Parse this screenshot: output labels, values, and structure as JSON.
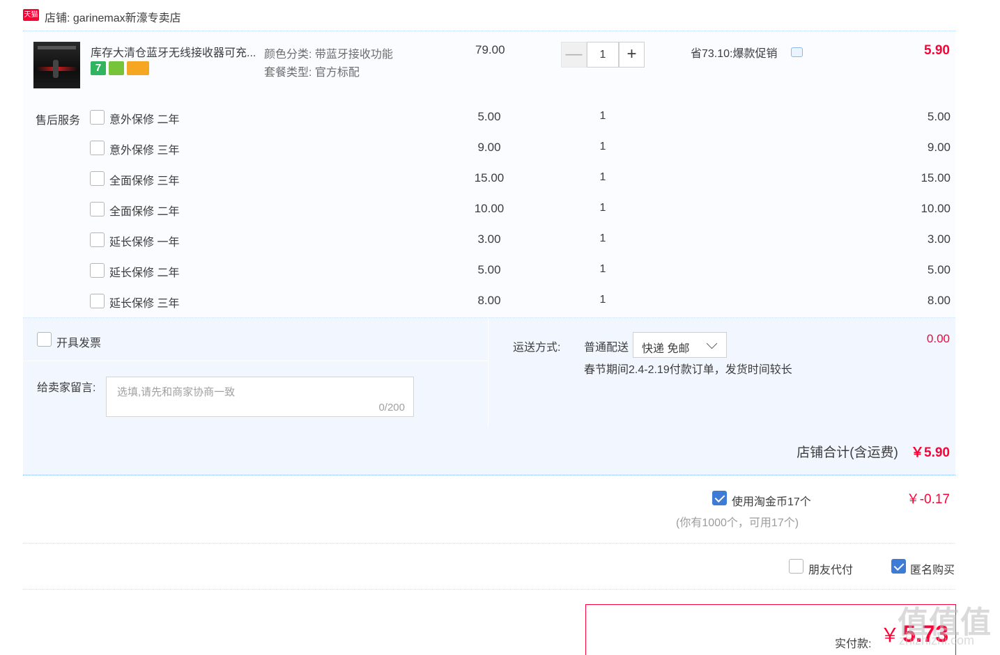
{
  "shop": {
    "badge_text": "天猫",
    "name": "店铺: garinemax新濠专卖店"
  },
  "item": {
    "title": "库存大清仓蓝牙无线接收器可充...",
    "badges": [
      "7",
      "",
      ""
    ],
    "sku_color_label": "颜色分类:",
    "sku_color_value": "带蓝牙接收功能",
    "sku_pkg_label": "套餐类型:",
    "sku_pkg_value": "官方标配",
    "unit_price": "79.00",
    "qty_minus": "—",
    "qty_value": "1",
    "qty_plus": "+",
    "promo": "省73.10:爆款促销",
    "total": "5.90"
  },
  "services": {
    "label": "售后服务",
    "rows": [
      {
        "name": "意外保修 二年",
        "price": "5.00",
        "qty": "1",
        "total": "5.00"
      },
      {
        "name": "意外保修 三年",
        "price": "9.00",
        "qty": "1",
        "total": "9.00"
      },
      {
        "name": "全面保修 三年",
        "price": "15.00",
        "qty": "1",
        "total": "15.00"
      },
      {
        "name": "全面保修 二年",
        "price": "10.00",
        "qty": "1",
        "total": "10.00"
      },
      {
        "name": "延长保修 一年",
        "price": "3.00",
        "qty": "1",
        "total": "3.00"
      },
      {
        "name": "延长保修 二年",
        "price": "5.00",
        "qty": "1",
        "total": "5.00"
      },
      {
        "name": "延长保修 三年",
        "price": "8.00",
        "qty": "1",
        "total": "8.00"
      }
    ]
  },
  "invoice": {
    "label": "开具发票"
  },
  "message": {
    "label": "给卖家留言:",
    "placeholder": "选填,请先和商家协商一致",
    "count": "0/200"
  },
  "shipping": {
    "label": "运送方式:",
    "type": "普通配送",
    "selected": "快递 免邮",
    "note": "春节期间2.4-2.19付款订单，发货时间较长",
    "fee": "0.00"
  },
  "shop_total": {
    "label": "店铺合计(含运费)",
    "amount": "￥5.90"
  },
  "coins": {
    "label": "使用淘金币17个",
    "sub": "(你有1000个，可用17个)",
    "amount": "￥-0.17",
    "checked": true
  },
  "options": {
    "friend_pay": "朋友代付",
    "anonymous": "匿名购买"
  },
  "payment": {
    "label": "实付款:",
    "currency": "￥",
    "amount": "5.73"
  },
  "watermark": {
    "big": "值值值",
    "small": "zhizhizhi.com"
  },
  "colors": {
    "accent_red": "#ff0036",
    "checkbox_blue": "#3d7bd6",
    "block_bg": "#f2f7ff"
  }
}
